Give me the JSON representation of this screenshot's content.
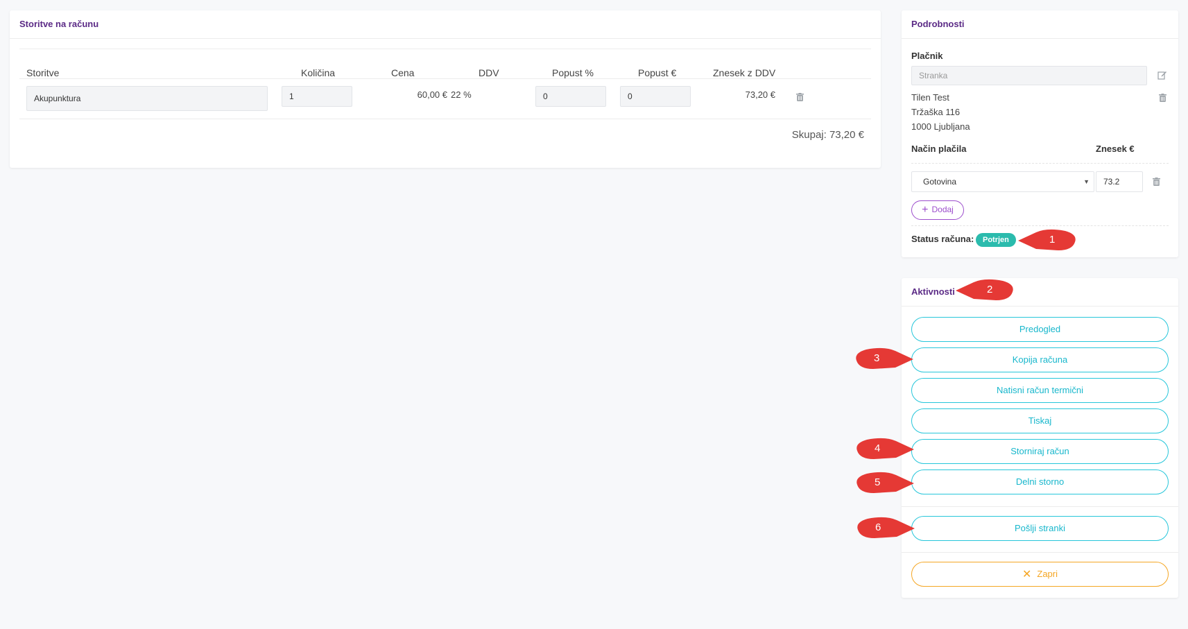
{
  "services": {
    "title": "Storitve na računu",
    "headers": {
      "service": "Storitve",
      "quantity": "Količina",
      "price": "Cena",
      "vat": "DDV",
      "discount_pct": "Popust %",
      "discount_eur": "Popust €",
      "amount_vat": "Znesek z DDV"
    },
    "rows": [
      {
        "service": "Akupunktura",
        "quantity": "1",
        "price": "60,00 €",
        "vat": "22 %",
        "discount_pct": "0",
        "discount_eur": "0",
        "amount_vat": "73,20 €"
      }
    ],
    "total": "Skupaj: 73,20 €"
  },
  "details": {
    "title": "Podrobnosti",
    "payer_label": "Plačnik",
    "payer_placeholder": "Stranka",
    "address": [
      "Tilen Test",
      "Tržaška 116",
      "1000 Ljubljana"
    ],
    "payment_method_label": "Način plačila",
    "amount_label": "Znesek €",
    "payment_method": "Gotovina",
    "payment_amount": "73.2",
    "add_label": "Dodaj",
    "status_label": "Status računa:",
    "status_value": "Potrjen"
  },
  "activities": {
    "title": "Aktivnosti",
    "buttons": [
      "Predogled",
      "Kopija računa",
      "Natisni račun termični",
      "Tiskaj",
      "Storniraj račun",
      "Delni storno"
    ],
    "send_label": "Pošlji stranki",
    "close_label": "Zapri"
  },
  "callouts": [
    "1",
    "2",
    "3",
    "4",
    "5",
    "6"
  ],
  "colors": {
    "title_purple": "#5b2a86",
    "cyan": "#26c6da",
    "badge_green": "#2bbbad",
    "close_orange": "#f5a623",
    "callout_red": "#e53935",
    "add_purple": "#9c4dcc"
  }
}
